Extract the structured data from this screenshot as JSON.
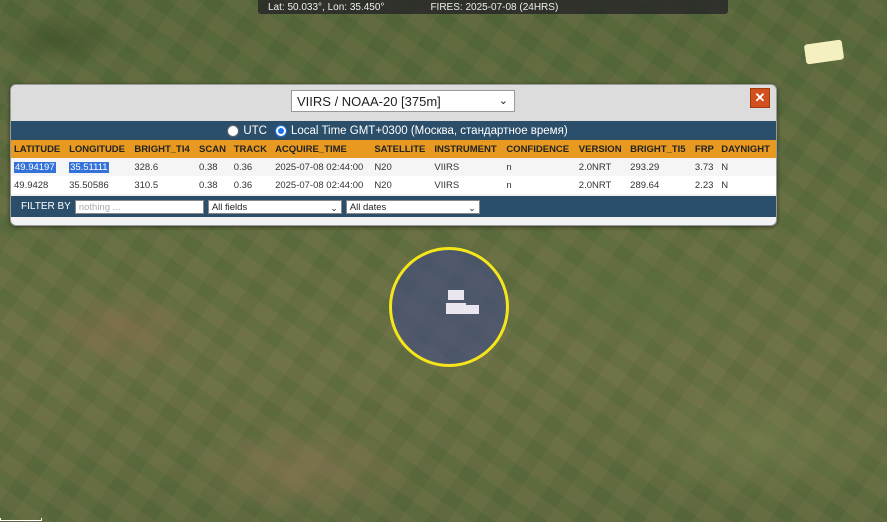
{
  "status": {
    "coords": "Lat: 50.033°, Lon: 35.450°",
    "fires": "FIRES: 2025-07-08 (24HRS)"
  },
  "popup": {
    "satellite_select": "VIIRS / NOAA-20 [375m]",
    "close_label": "✕",
    "tz_utc_label": "UTC",
    "tz_local_label": "Local Time GMT+0300 (Москва, стандартное время)",
    "columns": [
      "LATITUDE",
      "LONGITUDE",
      "BRIGHT_TI4",
      "SCAN",
      "TRACK",
      "ACQUIRE_TIME",
      "SATELLITE",
      "INSTRUMENT",
      "CONFIDENCE",
      "VERSION",
      "BRIGHT_TI5",
      "FRP",
      "DAYNIGHT"
    ],
    "rows": [
      [
        "49.94197",
        "35.51111",
        "328.6",
        "0.38",
        "0.36",
        "2025-07-08 02:44:00",
        "N20",
        "VIIRS",
        "n",
        "2.0NRT",
        "293.29",
        "3.73",
        "N"
      ],
      [
        "49.9428",
        "35.50586",
        "310.5",
        "0.38",
        "0.36",
        "2025-07-08 02:44:00",
        "N20",
        "VIIRS",
        "n",
        "2.0NRT",
        "289.64",
        "2.23",
        "N"
      ]
    ],
    "filter": {
      "label": "FILTER BY",
      "placeholder": "nothing ...",
      "field_select": "All fields",
      "date_select": "All dates"
    }
  },
  "colors": {
    "header_orange": "#e79a1f",
    "bar_blue": "#2b4f6a",
    "circle_yellow": "#f5e51b",
    "close_red": "#d2501f"
  }
}
